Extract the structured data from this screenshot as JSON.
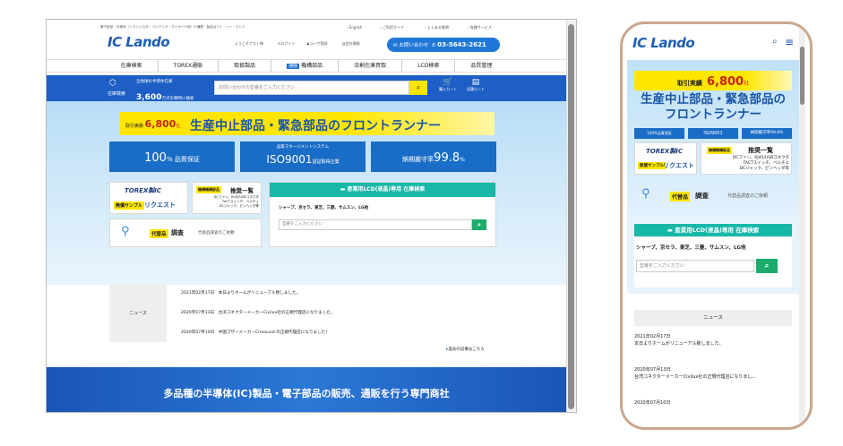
{
  "desktop": {
    "top_links": {
      "breadcrumb_text": "電子部品｜半導体（トランジスタ・コンデンサ・ダイオード他）IC通販・製品はアイ・シー・ランド",
      "english": "› English",
      "guide": "› ご利用ガイド",
      "faq": "› よくある質問",
      "services": "› 各種サービス"
    },
    "logo": "IC Lando",
    "header": {
      "welcome": "ようこそゲスト様",
      "login": "ログイン",
      "register": "ユーザ登録",
      "company": "会社情報",
      "contact_label": "お問い合わせ",
      "phone": "03-5643-2621"
    },
    "nav": [
      "在庫検索",
      "TOREX通販",
      "取扱製品",
      "機構部品",
      "余剰在庫買取",
      "LCD検索",
      "品質管理"
    ],
    "nav_badge": "通販",
    "search": {
      "label": "在庫検索",
      "subtitle": "全地球の半導体在庫",
      "count": "3,600",
      "count_suffix": "万点を瞬時に検索",
      "placeholder": "お問い合わせの型番をご入力ください",
      "cart1": "購入カート",
      "cart2": "見積カート",
      "cart1_count": "0",
      "cart2_count": "0"
    },
    "hero": {
      "record_label": "取引実績",
      "record_value": "6,800",
      "record_suffix": "社",
      "headline": "生産中止部品・緊急部品のフロントランナー",
      "box1_big": "100",
      "box1_small": "% 品質保証",
      "box2_top": "品質マネージメントシステム",
      "box2_big": "ISO9001",
      "box2_small": "認証取得企業",
      "box3_text": "納期厳守率",
      "box3_big": "99.8",
      "box3_small": "%"
    },
    "torex": {
      "brand": "TOREX製IC",
      "free": "無償サンプル",
      "request": "リクエスト",
      "tag": "機構機構部品",
      "title": "推奨一覧",
      "lines": [
        "DCファン、RJ45/USBコネクタ",
        "TACTスイッチ、ベルチェ",
        "DCジャック、ピンヘッダ等"
      ]
    },
    "alt": {
      "tag": "代替品",
      "title": "調査",
      "desc": "代替品調査のご依頼"
    },
    "lcd": {
      "title": "産業用LCD(液晶)専用 在庫検索",
      "makers": "シャープ、京セラ、東芝、三菱、サムスン、LG他",
      "placeholder": "型番をご入力ください"
    },
    "news": {
      "label": "ニュース",
      "items": [
        "2021年02月17日　本日よりホームがリニューアル致しました。",
        "2020年07月13日　台湾コネクターメーカーCivilux社の正規代理店になりました。",
        "2020年07月10日　中国ブザーメーカーCresound の正規代理店になりました！"
      ],
      "more": "過去の記事はこちら"
    },
    "footer_text": "多品種の半導体(IC)製品・電子部品の販売、通販を行う専門商社"
  },
  "mobile": {
    "logo": "IC Lando",
    "record_label": "取引実績",
    "record_value": "6,800",
    "record_suffix": "社",
    "headline1": "生産中止部品・緊急部品の",
    "headline2": "フロントランナー",
    "badge1": "100%品質保証",
    "badge2": "ISO9001",
    "badge3": "納期厳守率99.8%",
    "torex_brand": "TOREX製IC",
    "free": "無償サンプル",
    "request": "リクエスト",
    "tag": "機構機構部品",
    "tag_title": "推奨一覧",
    "lines": [
      "DCファン、RJ45/USBコネクタ",
      "TACTスイッチ、ベルチェ",
      "DCジャック、ピンヘッダ等"
    ],
    "alt_tag": "代替品",
    "alt_title": "調査",
    "alt_desc": "代替品調査のご依頼",
    "lcd_title": "産業用LCD(液晶)専用 在庫検索",
    "makers": "シャープ、京セラ、東芝、三菱、サムスン、LG他",
    "placeholder": "型番をご入力ください",
    "news_label": "ニュース",
    "news": [
      {
        "date": "2021年02月17日",
        "text": "本日よりホームがリニューアル致しました。"
      },
      {
        "date": "2020年07月13日",
        "text": "台湾コネクターメーカーCivilux社の正規代理店になりまし…"
      },
      {
        "date": "2020年07月10日",
        "text": ""
      }
    ]
  }
}
